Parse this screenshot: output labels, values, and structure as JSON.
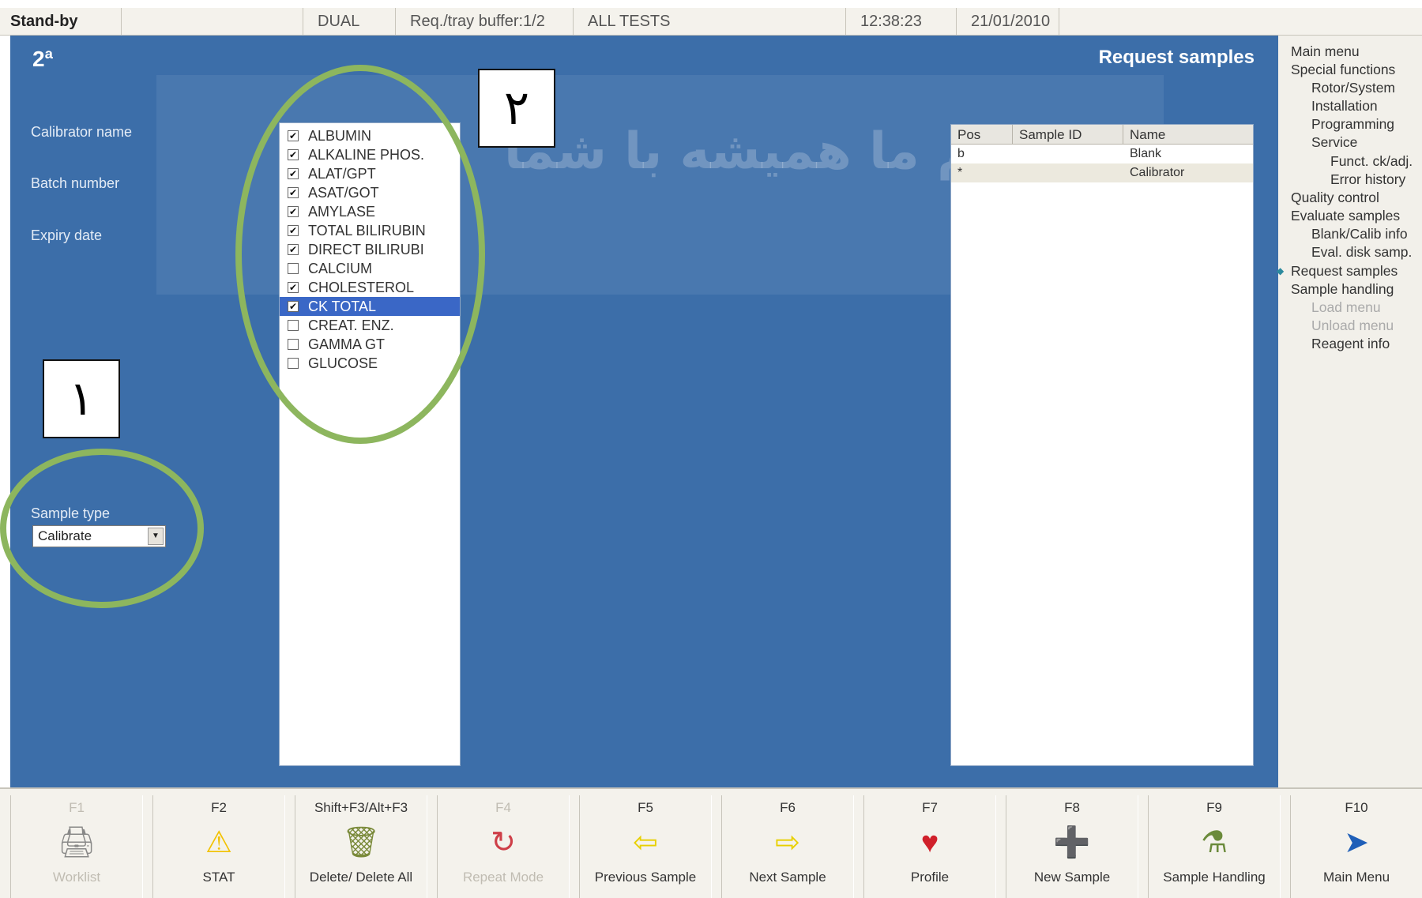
{
  "status_bar": {
    "state": "Stand-by",
    "mode": "DUAL",
    "buffer": "Req./tray buffer:1/2",
    "tests": "ALL TESTS",
    "time": "12:38:23",
    "date": "21/01/2010"
  },
  "main": {
    "page_index": "2ª",
    "title": "Request samples",
    "labels": {
      "calibrator_name": "Calibrator name",
      "batch_number": "Batch number",
      "expiry_date": "Expiry date",
      "sample_type": "Sample type"
    },
    "sample_type_value": "Calibrate"
  },
  "tests": [
    {
      "name": "ALBUMIN",
      "checked": true
    },
    {
      "name": "ALKALINE PHOS.",
      "checked": true
    },
    {
      "name": "ALAT/GPT",
      "checked": true
    },
    {
      "name": "ASAT/GOT",
      "checked": true
    },
    {
      "name": "AMYLASE",
      "checked": true
    },
    {
      "name": "TOTAL BILIRUBIN",
      "checked": true
    },
    {
      "name": "DIRECT BILIRUBI",
      "checked": true
    },
    {
      "name": "CALCIUM",
      "checked": false
    },
    {
      "name": "CHOLESTEROL",
      "checked": true
    },
    {
      "name": "CK TOTAL",
      "checked": true,
      "selected": true
    },
    {
      "name": "CREAT. ENZ.",
      "checked": false
    },
    {
      "name": "GAMMA GT",
      "checked": false
    },
    {
      "name": "GLUCOSE",
      "checked": false
    }
  ],
  "sample_grid": {
    "columns": [
      "Pos",
      "Sample ID",
      "Name"
    ],
    "rows": [
      {
        "pos": "b",
        "id": "",
        "name": "Blank"
      },
      {
        "pos": "*",
        "id": "",
        "name": "Calibrator"
      }
    ]
  },
  "annotations": {
    "marker_1": "١",
    "marker_2": "٢",
    "watermark": "تیم ما همیشه با شما"
  },
  "menu": [
    {
      "label": "Main menu",
      "level": 0
    },
    {
      "label": "Special functions",
      "level": 0
    },
    {
      "label": "Rotor/System",
      "level": 1
    },
    {
      "label": "Installation",
      "level": 1
    },
    {
      "label": "Programming",
      "level": 1
    },
    {
      "label": "Service",
      "level": 1
    },
    {
      "label": "Funct. ck/adj.",
      "level": 2
    },
    {
      "label": "Error history",
      "level": 2
    },
    {
      "label": "Quality control",
      "level": 0
    },
    {
      "label": "Evaluate samples",
      "level": 0
    },
    {
      "label": "Blank/Calib info",
      "level": 1
    },
    {
      "label": "Eval. disk samp.",
      "level": 1
    },
    {
      "label": "Request samples",
      "level": 0,
      "active": true
    },
    {
      "label": "Sample handling",
      "level": 0
    },
    {
      "label": "Load menu",
      "level": 1,
      "disabled": true
    },
    {
      "label": "Unload menu",
      "level": 1,
      "disabled": true
    },
    {
      "label": "Reagent info",
      "level": 1
    }
  ],
  "function_keys": [
    {
      "key": "F1",
      "label": "Worklist",
      "icon": "printer-icon",
      "glyph": "🖨",
      "enabled": false
    },
    {
      "key": "F2",
      "label": "STAT",
      "icon": "warning-icon",
      "glyph": "⚠",
      "enabled": true
    },
    {
      "key": "Shift+F3/Alt+F3",
      "label": "Delete/ Delete All",
      "icon": "trash-icon",
      "glyph": "🗑",
      "enabled": true
    },
    {
      "key": "F4",
      "label": "Repeat Mode",
      "icon": "repeat-icon",
      "glyph": "↻",
      "enabled": false
    },
    {
      "key": "F5",
      "label": "Previous Sample",
      "icon": "arrow-left-icon",
      "glyph": "⇦",
      "enabled": true
    },
    {
      "key": "F6",
      "label": "Next Sample",
      "icon": "arrow-right-icon",
      "glyph": "⇨",
      "enabled": true
    },
    {
      "key": "F7",
      "label": "Profile",
      "icon": "heart-card-icon",
      "glyph": "♥",
      "enabled": true
    },
    {
      "key": "F8",
      "label": "New Sample",
      "icon": "new-sample-icon",
      "glyph": "➕",
      "enabled": true
    },
    {
      "key": "F9",
      "label": "Sample Handling",
      "icon": "tubes-icon",
      "glyph": "⚗",
      "enabled": true
    },
    {
      "key": "F10",
      "label": "Main Menu",
      "icon": "navigate-icon",
      "glyph": "➤",
      "enabled": true
    }
  ],
  "colors": {
    "panel_blue": "#3c6ea9",
    "selection_blue": "#3a67c6",
    "ellipse_green": "#8db65e",
    "warning_yellow": "#f2c200",
    "arrow_yellow": "#e8d000",
    "repeat_red": "#c8202c",
    "nav_blue": "#1f5fb8"
  }
}
